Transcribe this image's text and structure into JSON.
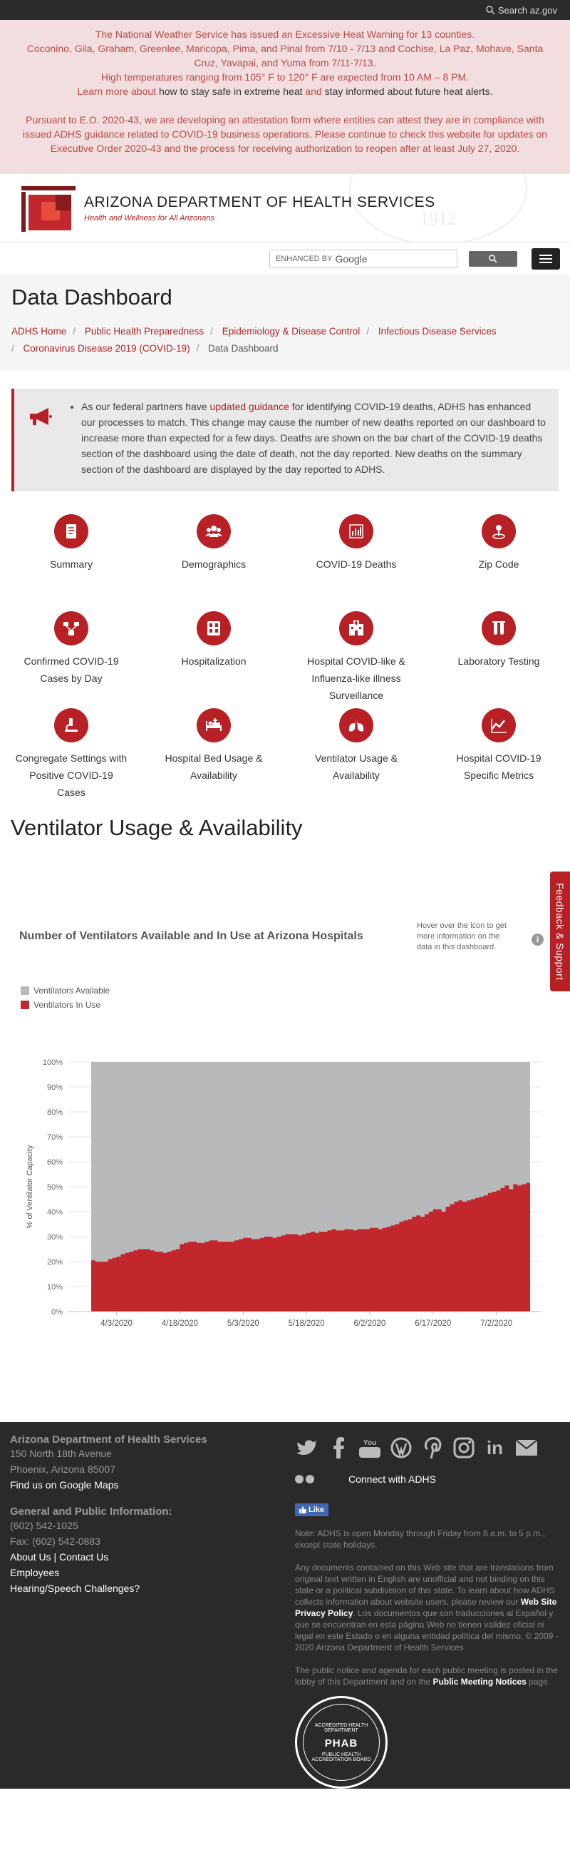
{
  "topbar": {
    "search_label": "Search az.gov"
  },
  "alert": {
    "line1": "The National Weather Service has issued an Excessive Heat Warning for 13 counties.",
    "line2": "Coconino, Gila, Graham, Greenlee, Maricopa, Pima, and Pinal from 7/10 - 7/13 and Cochise, La Paz, Mohave, Santa Cruz, Yavapai, and Yuma from 7/11-7/13.",
    "line3": "High temperatures ranging from 105° F to 120° F are expected from 10 AM – 8 PM.",
    "learn_link": "Learn more about",
    "learn_mid": "how to stay safe in extreme heat",
    "learn_and": "and",
    "learn_end": "stay informed about future heat alerts.",
    "eo_pre": "Pursuant to E.O. 2020-43,",
    "eo_text": "we are developing an attestation form where entities can attest they are in compliance with issued ADHS guidance related to COVID-19 business operations. Please continue to check this website for updates on Executive Order 2020-43 and the process for receiving authorization to reopen after at least July 27, 2020."
  },
  "brand": {
    "title": "ARIZONA DEPARTMENT OF HEALTH SERVICES",
    "tagline": "Health and Wellness for All Arizonans",
    "seal_year": "1912"
  },
  "search": {
    "enhanced_by": "ENHANCED BY",
    "google": "Google"
  },
  "page": {
    "title": "Data Dashboard"
  },
  "breadcrumb": [
    "ADHS Home",
    "Public Health Preparedness",
    "Epidemiology & Disease Control",
    "Infectious Disease Services",
    "Coronavirus Disease 2019 (COVID-19)",
    "Data Dashboard"
  ],
  "notice": {
    "pre": "As our federal partners have",
    "link": "updated guidance",
    "post": "for identifying COVID-19 deaths, ADHS has enhanced our processes to match. This change may cause the number of new deaths reported on our dashboard to increase more than expected for a few days. Deaths are shown on the bar chart of the COVID-19 deaths section of the dashboard using the date of death, not the day reported. New deaths on the summary section of the dashboard are displayed by the day reported to ADHS."
  },
  "dashboard_links": [
    {
      "label": "Summary",
      "icon": "summary-icon"
    },
    {
      "label": "Demographics",
      "icon": "demographics-icon"
    },
    {
      "label": "COVID-19 Deaths",
      "icon": "bar-chart-icon"
    },
    {
      "label": "Zip Code",
      "icon": "map-pin-icon"
    },
    {
      "label": "Confirmed COVID-19 Cases by Day",
      "icon": "network-icon"
    },
    {
      "label": "Hospitalization",
      "icon": "hospital-beds-icon"
    },
    {
      "label": "Hospital COVID-like & Influenza-like illness Surveillance",
      "icon": "hospital-building-icon"
    },
    {
      "label": "Laboratory Testing",
      "icon": "test-tubes-icon"
    },
    {
      "label": "Congregate Settings with Positive COVID-19 Cases",
      "icon": "microscope-icon"
    },
    {
      "label": "Hospital Bed Usage & Availability",
      "icon": "hospital-bed-icon"
    },
    {
      "label": "Ventilator Usage & Availability",
      "icon": "lungs-icon"
    },
    {
      "label": "Hospital COVID-19 Specific Metrics",
      "icon": "line-chart-icon"
    }
  ],
  "section": {
    "title": "Ventilator Usage & Availability"
  },
  "feedback": {
    "label": "Feedback & Support"
  },
  "chart_hint": "Hover over the icon to get more information on the data in this dashboard.",
  "chart_data": {
    "type": "area",
    "title": "Number of Ventilators Available and In Use at Arizona Hospitals",
    "ylabel": "% of Ventilator Capacity",
    "xlabel": "",
    "ylim": [
      0,
      100
    ],
    "y_ticks": [
      "0%",
      "10%",
      "20%",
      "30%",
      "40%",
      "50%",
      "60%",
      "70%",
      "80%",
      "90%",
      "100%"
    ],
    "x_ticks": [
      "4/3/2020",
      "4/18/2020",
      "5/3/2020",
      "5/18/2020",
      "6/2/2020",
      "6/17/2020",
      "7/2/2020"
    ],
    "x_tick_days": [
      6,
      21,
      36,
      51,
      66,
      81,
      96
    ],
    "legend": "top-left",
    "colors": {
      "available": "#b7b9ba",
      "in_use": "#c1272d"
    },
    "series": [
      {
        "name": "Ventilators Available"
      },
      {
        "name": "Ventilators In Use"
      }
    ],
    "start_date": "3/28/2020",
    "in_use_pct": [
      20.5,
      20,
      20,
      20,
      21,
      21.5,
      22,
      23,
      23.5,
      24,
      24.5,
      25,
      25,
      25,
      24.5,
      24,
      24,
      23.5,
      24,
      24.5,
      25,
      27,
      27.5,
      28,
      28,
      27.5,
      27.5,
      28,
      28.5,
      28.5,
      28,
      28,
      28,
      28,
      28.5,
      29,
      29.5,
      29.5,
      29,
      29,
      29.5,
      30,
      30,
      29.5,
      30,
      30.5,
      31,
      31,
      31,
      30.5,
      31,
      31.5,
      32,
      31.5,
      32,
      32,
      32.5,
      33,
      32.5,
      32.5,
      33,
      33,
      32.5,
      33,
      33,
      33,
      33.5,
      33.5,
      33,
      33.5,
      34,
      34.5,
      35,
      36,
      36.5,
      37,
      38,
      38.5,
      38,
      39,
      40,
      41,
      41,
      40,
      42,
      43,
      44,
      44.5,
      44,
      44.5,
      45,
      45.5,
      46,
      46.5,
      47.5,
      48,
      48.5,
      49.5,
      50.5,
      49,
      51,
      50.5,
      51,
      51.5,
      51
    ]
  },
  "footer": {
    "org": "Arizona Department of Health Services",
    "addr1": "150 North 18th Avenue",
    "addr2": "Phoenix, Arizona 85007",
    "maps": "Find us on Google Maps",
    "gen_head": "General and Public Information:",
    "phone": "(602) 542-1025",
    "fax": "Fax: (602) 542-0883",
    "about": "About Us",
    "contact": "Contact Us",
    "employees": "Employees",
    "hearing": "Hearing/Speech Challenges?",
    "connect": "Connect with ADHS",
    "like": "Like",
    "note": "Note: ADHS is open Monday through Friday from 8 a.m. to 5 p.m., except state holidays.",
    "legal_pre": "Any documents contained on this Web site that are translations from original text written in English are unofficial and not binding on this state or a political subdivision of this state. To learn about how ADHS collects information about website users, please review our",
    "privacy": "Web Site Privacy Policy",
    "legal_post": ". Los documentos que son traducciones al Español y que se encuentran en esta página Web no tienen validez oficial ni legal en este Estado o en alguna entidad política del mismo. © 2009 - 2020 Arizona Department of Health Services",
    "notice_pre": "The public notice and agenda for each public meeting is posted in the lobby of this Department and on the",
    "notice_link": "Public Meeting Notices",
    "notice_post": "page.",
    "badge_top": "ACCREDITED HEALTH DEPARTMENT",
    "badge_mid": "PHAB",
    "badge_bot": "PUBLIC HEALTH ACCREDITATION BOARD"
  }
}
